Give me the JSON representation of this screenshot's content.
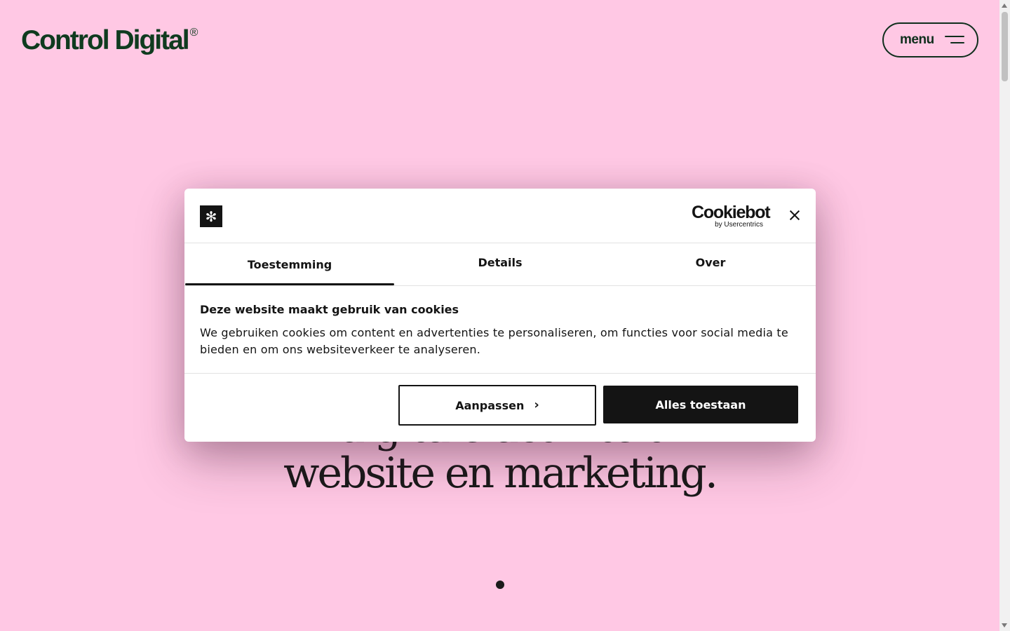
{
  "header": {
    "logo_text": "Control Digital",
    "logo_mark": "®",
    "menu_label": "menu"
  },
  "hero": {
    "line_1": "digitale activiteit",
    "line_2": "website en marketing."
  },
  "cookie_dialog": {
    "brand_mark_glyph": "✻",
    "provider_name": "Cookiebot",
    "provider_sub": "by Usercentrics",
    "tabs": [
      {
        "label": "Toestemming",
        "active": true
      },
      {
        "label": "Details",
        "active": false
      },
      {
        "label": "Over",
        "active": false
      }
    ],
    "title": "Deze website maakt gebruik van cookies",
    "body": "We gebruiken cookies om content en advertenties te personaliseren, om functies voor social media te bieden en om ons websiteverkeer te analyseren.",
    "customize_label": "Aanpassen",
    "allow_all_label": "Alles toestaan"
  },
  "colors": {
    "background": "#ffc8e4",
    "logo": "#0f3b1f",
    "dialog_bg": "#ffffff",
    "primary_button": "#141414"
  },
  "icons": {
    "close": "close-icon",
    "chevron": "chevron-right-icon",
    "menu": "hamburger-icon"
  }
}
